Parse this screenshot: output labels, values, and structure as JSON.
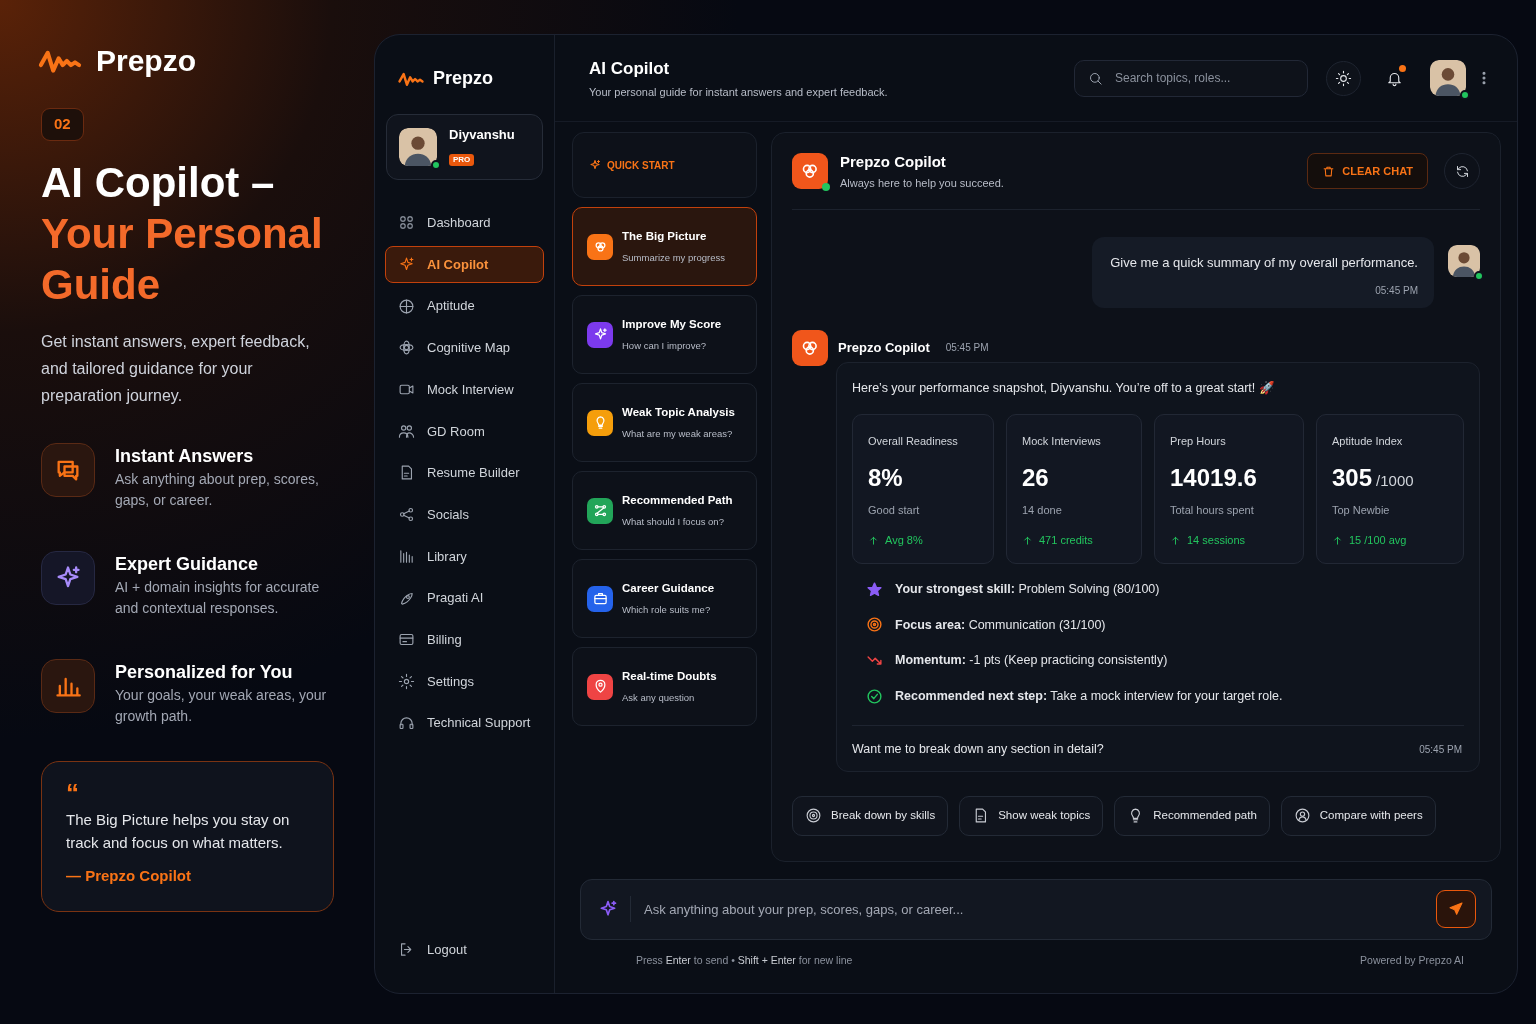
{
  "promo": {
    "logo": "Prepzo",
    "step": "02",
    "title": "AI Copilot –",
    "title_accent": "Your Personal Guide",
    "intro": "Get instant answers, expert feedback, and tailored guidance for your preparation journey.",
    "features": [
      {
        "title": "Instant Answers",
        "text": "Ask anything about prep, scores, gaps, or career."
      },
      {
        "title": "Expert Guidance",
        "text": "AI + domain insights for accurate and contextual responses."
      },
      {
        "title": "Personalized for You",
        "text": "Your goals, your weak areas, your growth path."
      }
    ],
    "quote": {
      "mark": "“",
      "text": "The Big Picture helps you stay on track and focus on what matters.",
      "author": "— Prepzo Copilot"
    }
  },
  "sidebar": {
    "logo": "Prepzo",
    "user": {
      "name": "Diyvanshu",
      "badge": "PRO",
      "online": true
    },
    "items": [
      {
        "label": "Dashboard",
        "selected": false
      },
      {
        "label": "AI Copilot",
        "selected": true
      },
      {
        "label": "Aptitude",
        "selected": false
      },
      {
        "label": "Cognitive Map",
        "selected": false
      },
      {
        "label": "Mock Interview",
        "selected": false
      },
      {
        "label": "GD Room",
        "selected": false
      },
      {
        "label": "Resume Builder",
        "selected": false
      },
      {
        "label": "Socials",
        "selected": false
      },
      {
        "label": "Library",
        "selected": false
      },
      {
        "label": "Pragati AI",
        "selected": false
      },
      {
        "label": "Billing",
        "selected": false
      },
      {
        "label": "Settings",
        "selected": false
      },
      {
        "label": "Technical Support",
        "selected": false
      }
    ],
    "logout": "Logout"
  },
  "header": {
    "title": "AI Copilot",
    "subtitle": "Your personal guide for instant answers and expert feedback.",
    "search": {
      "placeholder": "Search topics, roles..."
    },
    "notifications_unread": true,
    "user_online": true
  },
  "quick_start": {
    "title": "QUICK START",
    "items": [
      {
        "title": "The Big Picture",
        "subtitle": "Summarize my progress",
        "color": "#f97316",
        "selected": true
      },
      {
        "title": "Improve My Score",
        "subtitle": "How can I improve?",
        "color": "#7c3aed",
        "selected": false
      },
      {
        "title": "Weak Topic Analysis",
        "subtitle": "What are my weak areas?",
        "color": "#f59e0b",
        "selected": false
      },
      {
        "title": "Recommended Path",
        "subtitle": "What should I focus on?",
        "color": "#22a559",
        "selected": false
      },
      {
        "title": "Career Guidance",
        "subtitle": "Which role suits me?",
        "color": "#2563eb",
        "selected": false
      },
      {
        "title": "Real-time Doubts",
        "subtitle": "Ask any question",
        "color": "#ef4444",
        "selected": false
      }
    ]
  },
  "chat": {
    "bot_name": "Prepzo Copilot",
    "bot_status": "Always here to help you succeed.",
    "bot_online": true,
    "clear_button": "CLEAR CHAT",
    "user_message": {
      "text": "Give me a quick summary of my overall performance.",
      "time": "05:45 PM",
      "online": true
    },
    "reply": {
      "sender": "Prepzo Copilot",
      "time": "05:45 PM",
      "intro": "Here’s your performance snapshot, Diyvanshu. You’re off to a great start! 🚀",
      "stats": [
        {
          "label": "Overall Readiness",
          "value": "8%",
          "note": "Good start",
          "trend": "Avg 8%"
        },
        {
          "label": "Mock Interviews",
          "value": "26",
          "note": "14 done",
          "trend": "471 credits"
        },
        {
          "label": "Prep Hours",
          "value": "14019.6",
          "note": "Total hours spent",
          "trend": "14 sessions"
        },
        {
          "label": "Aptitude Index",
          "value": "305",
          "unit": "/1000",
          "note": "Top Newbie",
          "trend": "15 /100 avg"
        }
      ],
      "insights": [
        {
          "kind": "star",
          "text": "**Your strongest skill:** Problem Solving (80/100)"
        },
        {
          "kind": "target",
          "text": "**Focus area:** Communication (31/100)"
        },
        {
          "kind": "decline",
          "text": "**Momentum:** -1 pts (Keep practicing consistently)"
        },
        {
          "kind": "check",
          "text": "**Recommended next step:** Take a mock interview for your target role."
        }
      ],
      "closing": "Want me to break down any section in detail?",
      "closing_time": "05:45 PM"
    },
    "suggestions": [
      "Break down by skills",
      "Show weak topics",
      "Recommended path",
      "Compare with peers"
    ],
    "input": {
      "placeholder": "Ask anything about your prep, scores, gaps, or career..."
    },
    "hint": "Press **Enter** to send • **Shift + Enter** for new line",
    "powered_by": "Powered by Prepzo AI"
  }
}
